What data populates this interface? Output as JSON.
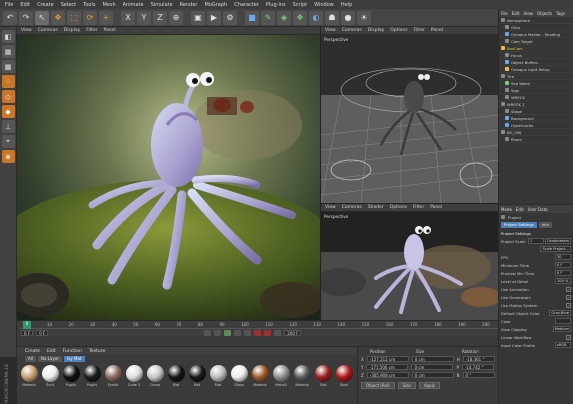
{
  "menubar": [
    "File",
    "Edit",
    "Create",
    "Select",
    "Tools",
    "Mesh",
    "Animate",
    "Simulate",
    "Render",
    "MoGraph",
    "Character",
    "Plug-ins",
    "Script",
    "Window",
    "Help"
  ],
  "layout_label": "Layout:",
  "viewport_main": {
    "menu": [
      "View",
      "Cameras",
      "Display",
      "Filter",
      "Panel"
    ]
  },
  "viewport_persp": {
    "menu": [
      "View",
      "Cameras",
      "Display",
      "Options",
      "Filter",
      "Panel"
    ],
    "label": "Perspective"
  },
  "viewport_render": {
    "menu": [
      "View",
      "Cameras",
      "Shader",
      "Options",
      "Filter",
      "Panel"
    ],
    "label": "Perspective"
  },
  "timeline": {
    "ticks": [
      "0",
      "10",
      "20",
      "30",
      "40",
      "50",
      "60",
      "70",
      "80",
      "90",
      "100",
      "110",
      "120",
      "130",
      "140",
      "150",
      "160",
      "170",
      "180",
      "190",
      "200"
    ],
    "playhead": "0",
    "start": "0 F",
    "end": "200 F",
    "frame": "0 F"
  },
  "materials": {
    "menu": [
      "Create",
      "Edit",
      "Function",
      "Texture"
    ],
    "tabs": [
      "All",
      "No Layer",
      "Ivy Mat"
    ],
    "items": [
      {
        "name": "Materia",
        "color": "#c8a070"
      },
      {
        "name": "Scrif",
        "color": "#eeeeee"
      },
      {
        "name": "Pupils",
        "color": "#111111"
      },
      {
        "name": "Pupils",
        "color": "#1a1a1a"
      },
      {
        "name": "Eyelid",
        "color": "#8a6a5a"
      },
      {
        "name": "Cube 2",
        "color": "#dddddd"
      },
      {
        "name": "Comp",
        "color": "#c8c8c8"
      },
      {
        "name": "Mat",
        "color": "#151515"
      },
      {
        "name": "Mat",
        "color": "#181818"
      },
      {
        "name": "Mat",
        "color": "#bbbbbb"
      },
      {
        "name": "Gloss",
        "color": "#ebebeb"
      },
      {
        "name": "Materia",
        "color": "#9a5a2a"
      },
      {
        "name": "Metalli",
        "color": "#909090"
      },
      {
        "name": "Materia",
        "color": "#5a5a5a"
      },
      {
        "name": "Sub",
        "color": "#9a2020"
      },
      {
        "name": "Spot",
        "color": "#b01818"
      }
    ]
  },
  "coords": {
    "headers": [
      "Position",
      "Size",
      "Rotation"
    ],
    "rows": [
      {
        "axis": "X",
        "pos": "-127.212 cm",
        "size": "0 cm",
        "rot": "H",
        "rotv": "-18.361 °"
      },
      {
        "axis": "Y",
        "pos": "-171.506 cm",
        "size": "0 cm",
        "rot": "P",
        "rotv": "-14.742 °"
      },
      {
        "axis": "Z",
        "pos": "-305.908 cm",
        "size": "0 cm",
        "rot": "B",
        "rotv": "0 °"
      }
    ],
    "mode": "Object (Rel)",
    "size_mode": "Size",
    "apply": "Apply"
  },
  "objects": {
    "menu": [
      "File",
      "Edit",
      "View",
      "Objects",
      "Tags"
    ],
    "items": [
      {
        "name": "Atmosphere",
        "color": "#8a8a8a"
      },
      {
        "name": "Octo",
        "color": "#8a8a8a"
      },
      {
        "name": "Octopus Master - Shading",
        "color": "#6aa8f0"
      },
      {
        "name": "Cam Target",
        "color": "#8a8a8a"
      },
      {
        "name": "BoxCam",
        "color": "#f0c030",
        "sel": true
      },
      {
        "name": "Focus",
        "color": "#8a8a8a"
      },
      {
        "name": "Object Buffers",
        "color": "#6aa8f0"
      },
      {
        "name": "Octopus Light Setup",
        "color": "#f0c030"
      },
      {
        "name": "Tire",
        "color": "#8a8a8a"
      },
      {
        "name": "Sea Weed",
        "color": "#7cd07c"
      },
      {
        "name": "Sign",
        "color": "#8a8a8a"
      },
      {
        "name": "WRECK",
        "color": "#8a8a8a"
      },
      {
        "name": "WRECK 2",
        "color": "#8a8a8a"
      },
      {
        "name": "Stage",
        "color": "#8a8a8a"
      },
      {
        "name": "Background",
        "color": "#6aa8f0"
      },
      {
        "name": "Hypernurbs",
        "color": "#6aa8f0"
      },
      {
        "name": "BG_OBJ",
        "color": "#8a8a8a"
      },
      {
        "name": "Room",
        "color": "#8a8a8a"
      }
    ]
  },
  "attributes": {
    "menu": [
      "Mode",
      "Edit",
      "User Data"
    ],
    "title": "Project",
    "tabs": [
      "Project Settings",
      "Info"
    ],
    "section": "Project Settings",
    "rows": [
      {
        "label": "Project Scale",
        "value": "1",
        "unit": "Centimeters"
      },
      {
        "label": "",
        "value": "Scale Project..."
      },
      {
        "label": "FPS",
        "value": "30"
      },
      {
        "label": "Minimum Time",
        "value": "0 F"
      },
      {
        "label": "Preview Min Time",
        "value": "0 F"
      },
      {
        "label": "Level of Detail",
        "value": "100 %"
      },
      {
        "label": "Use Animation",
        "check": "✓"
      },
      {
        "label": "Use Generators",
        "check": "✓"
      },
      {
        "label": "Use Motion System",
        "check": "✓"
      },
      {
        "label": "Default Object Color",
        "value": "Gray-Blue"
      },
      {
        "label": "Color",
        "value": ""
      },
      {
        "label": "View Clipping",
        "value": "Medium"
      },
      {
        "label": "Linear Workflow",
        "check": "✓"
      },
      {
        "label": "Input Color Profile",
        "value": "sRGB"
      }
    ],
    "time_vals": [
      "200 F",
      "200 F"
    ]
  },
  "side_brand": "MAXON CINEMA 4D"
}
